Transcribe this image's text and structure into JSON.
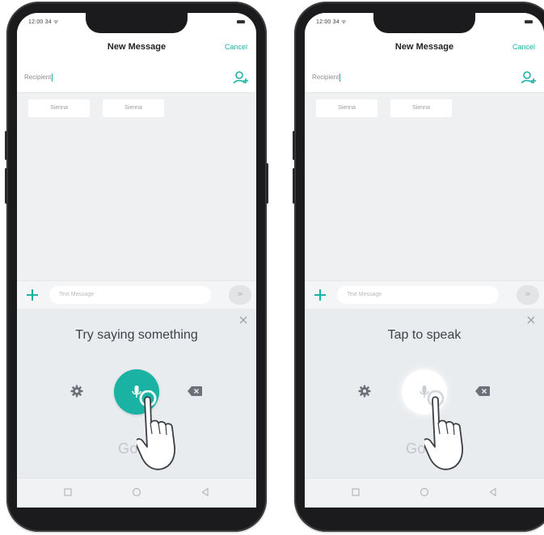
{
  "phones": [
    {
      "status_time": "12:00 34 ᯤ",
      "header": {
        "title": "New Message",
        "cancel": "Cancel"
      },
      "recipient": {
        "label": "Recipient"
      },
      "suggestions": [
        "Sienna",
        "Sienna"
      ],
      "compose": {
        "placeholder": "Text Message",
        "send": "≫"
      },
      "voice": {
        "prompt": "Try saying something",
        "mic_state": "listening",
        "logo": "Goog"
      }
    },
    {
      "status_time": "12:00 34 ᯤ",
      "header": {
        "title": "New Message",
        "cancel": "Cancel"
      },
      "recipient": {
        "label": "Recipient"
      },
      "suggestions": [
        "Sienna",
        "Sienna"
      ],
      "compose": {
        "placeholder": "Text Message",
        "send": "≫"
      },
      "voice": {
        "prompt": "Tap to speak",
        "mic_state": "idle",
        "logo": "Goog"
      }
    }
  ],
  "colors": {
    "accent": "#1ab2a2",
    "panel": "#e9ecef",
    "frame": "#1b1b1d"
  },
  "icons": {
    "add_contact": "add-contact-icon",
    "plus": "plus-icon",
    "close": "close-icon",
    "settings": "gear-icon",
    "mic": "microphone-icon",
    "backspace": "backspace-icon",
    "hand": "hand-pointer-icon",
    "nav": [
      "recent-apps-icon",
      "home-icon",
      "back-icon"
    ]
  }
}
